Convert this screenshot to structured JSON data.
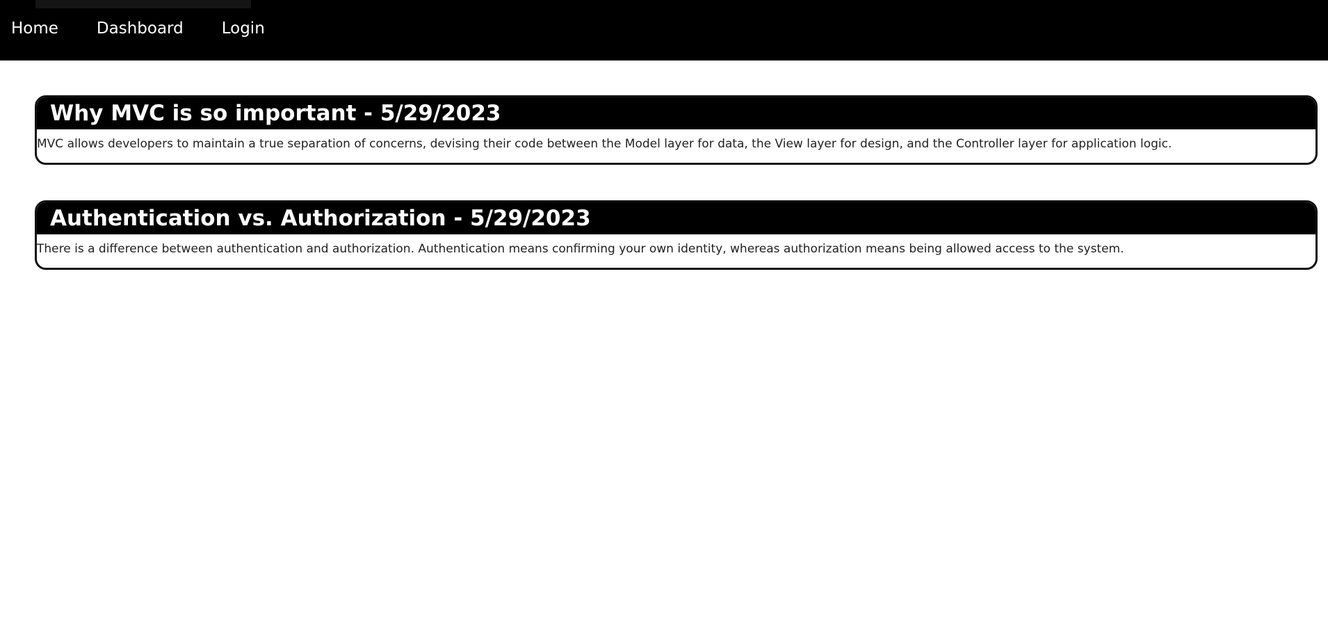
{
  "nav": {
    "links": [
      {
        "label": "Home"
      },
      {
        "label": "Dashboard"
      },
      {
        "label": "Login"
      }
    ]
  },
  "posts": [
    {
      "title": "Why MVC is so important - 5/29/2023",
      "body": "MVC allows developers to maintain a true separation of concerns, devising their code between the Model layer for data, the View layer for design, and the Controller layer for application logic."
    },
    {
      "title": "Authentication vs. Authorization - 5/29/2023",
      "body": "There is a difference between authentication and authorization. Authentication means confirming your own identity, whereas authorization means being allowed access to the system."
    }
  ],
  "colors": {
    "navbar_bg": "#000000",
    "nav_text": "#ffffff",
    "card_header_bg": "#000000",
    "card_border": "#111111",
    "body_text": "#222222"
  }
}
